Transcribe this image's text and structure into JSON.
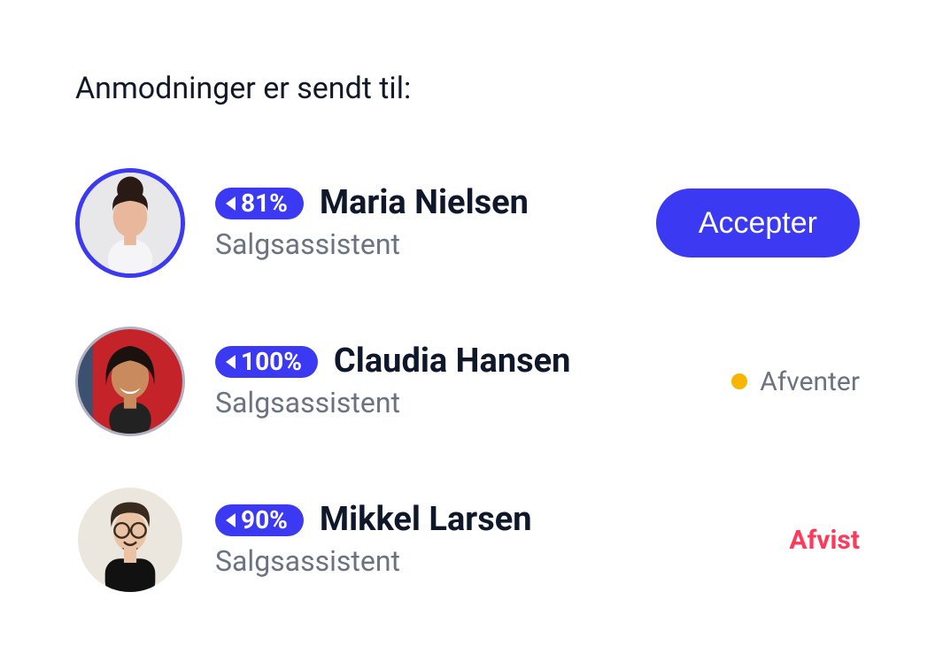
{
  "heading": "Anmodninger er sendt til:",
  "accept_label": "Accepter",
  "requests": [
    {
      "match": "81%",
      "name": "Maria Nielsen",
      "role": "Salgsassistent",
      "action": {
        "type": "button"
      }
    },
    {
      "match": "100%",
      "name": "Claudia Hansen",
      "role": "Salgsassistent",
      "action": {
        "type": "status",
        "label": "Afventer",
        "state": "pending"
      }
    },
    {
      "match": "90%",
      "name": "Mikkel Larsen",
      "role": "Salgsassistent",
      "action": {
        "type": "status",
        "label": "Afvist",
        "state": "rejected"
      }
    }
  ]
}
